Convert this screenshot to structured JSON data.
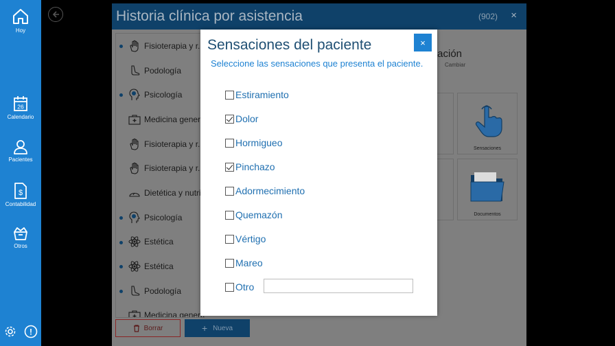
{
  "nav": {
    "items": [
      {
        "label": "Hoy",
        "icon": "home-icon"
      },
      {
        "label": "Calendario",
        "icon": "calendar-icon",
        "badge": "26"
      },
      {
        "label": "Pacientes",
        "icon": "person-icon"
      },
      {
        "label": "Contabilidad",
        "icon": "document-dollar-icon"
      },
      {
        "label": "Otros",
        "icon": "box-icon"
      }
    ],
    "bottom": [
      {
        "icon": "gear-icon"
      },
      {
        "icon": "info-icon",
        "glyph": "!"
      }
    ]
  },
  "background_window": {
    "title": "Historia clínica por asistencia",
    "count": "(902)",
    "close": "×",
    "list": [
      {
        "label": "Fisioterapia y r...",
        "icon": "hand-icon",
        "dot": true
      },
      {
        "label": "Podología",
        "icon": "foot-icon",
        "dot": false
      },
      {
        "label": "Psicología",
        "icon": "head-icon",
        "dot": true
      },
      {
        "label": "Medicina general",
        "icon": "medkit-icon",
        "dot": false
      },
      {
        "label": "Fisioterapia y r...",
        "icon": "hand-icon",
        "dot": false
      },
      {
        "label": "Fisioterapia y r...",
        "icon": "hand-icon",
        "dot": false
      },
      {
        "label": "Dietética y nutrición",
        "icon": "scale-icon",
        "dot": false
      },
      {
        "label": "Psicología",
        "icon": "head-icon",
        "dot": true
      },
      {
        "label": "Estética",
        "icon": "atom-icon",
        "dot": true
      },
      {
        "label": "Estética",
        "icon": "atom-icon",
        "dot": true
      },
      {
        "label": "Podología",
        "icon": "foot-icon",
        "dot": true
      },
      {
        "label": "Medicina general",
        "icon": "medkit-icon",
        "dot": false
      }
    ],
    "side_title": "tación",
    "side_sub": "Cambiar",
    "tiles": [
      {
        "label": "Sensaciones",
        "icon": "touch-hand-icon"
      },
      {
        "label": "Documentos",
        "icon": "folder-icon"
      }
    ],
    "buttons": {
      "delete": "Borrar",
      "new": "Nueva"
    }
  },
  "modal": {
    "title": "Sensaciones del paciente",
    "subtitle": "Seleccione las sensaciones que presenta el paciente.",
    "close": "×",
    "options": [
      {
        "label": "Estiramiento",
        "checked": false
      },
      {
        "label": "Dolor",
        "checked": true
      },
      {
        "label": "Hormigueo",
        "checked": false
      },
      {
        "label": "Pinchazo",
        "checked": true
      },
      {
        "label": "Adormecimiento",
        "checked": false
      },
      {
        "label": "Quemazón",
        "checked": false
      },
      {
        "label": "Vértigo",
        "checked": false
      },
      {
        "label": "Mareo",
        "checked": false
      },
      {
        "label": "Otro",
        "checked": false
      }
    ],
    "otro_value": ""
  }
}
